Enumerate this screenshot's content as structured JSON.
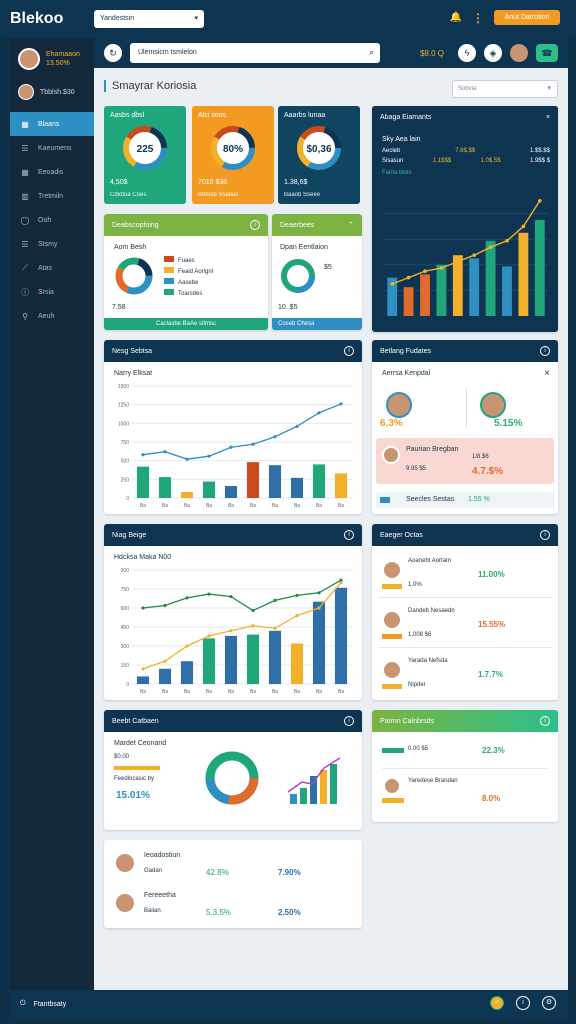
{
  "app": {
    "logo": "Blekoo",
    "workspace_select": "Yandestsin",
    "top_button": "Anut Datrotion"
  },
  "sidebar": {
    "user_name": "Ehamaaon",
    "user_sub": "13.50%",
    "workspace": "Tbblsh.$30",
    "items": [
      {
        "label": "Blaans",
        "icon": "table-icon"
      },
      {
        "label": "Kaeumens",
        "icon": "list-icon"
      },
      {
        "label": "Eeoadis",
        "icon": "table-icon"
      },
      {
        "label": "Tretmiln",
        "icon": "grid-icon"
      },
      {
        "label": "Ooh",
        "icon": "circle-icon"
      },
      {
        "label": "Stsmy",
        "icon": "list-icon"
      },
      {
        "label": "Atas",
        "icon": "chart-icon"
      },
      {
        "label": "Srsia",
        "icon": "info-icon"
      },
      {
        "label": "Aeuh",
        "icon": "pin-icon"
      }
    ]
  },
  "search": {
    "placeholder": "Ulemsicm tsmlelon",
    "status": "$8.0 Q"
  },
  "page": {
    "title": "Smayrar Koriosia",
    "filter": "Sobvia"
  },
  "kpis": [
    {
      "title": "Aasbs dbsl",
      "center": "225",
      "value": "4,50$",
      "sub": "Cdiotoa Coes",
      "color": "#1fa67a"
    },
    {
      "title": "Alci soos",
      "center": "80%",
      "value": "7010 $38",
      "sub": "Bdmsb Ssabus",
      "color": "#f39a22"
    },
    {
      "title": "Aaarbs lunaa",
      "center": "$0,36",
      "value": "1.38,6$",
      "sub": "Baaob Sseee",
      "color": "#0f4561"
    }
  ],
  "breakdown": {
    "title": "Deabscopfoing",
    "heading": "Aom Besh",
    "legend": [
      "Fuaes",
      "Feaid Aorlgnl",
      "Aasebe",
      "Toarsdes"
    ],
    "total": "7.58",
    "footer": "Caclasbe BaAe stimsc"
  },
  "dist": {
    "title": "Deaerbees",
    "heading": "Dpan Eentlaion",
    "value": "$5",
    "total": "10. $5",
    "footer": "Coseb Chesa"
  },
  "big": {
    "title": "Abaga Eiamants",
    "heading": "Sky Aea lain",
    "r1": [
      "Aecleb",
      "7.6$.$$",
      "1.$$.$$"
    ],
    "r2": [
      "Sisasun",
      "1.1$$$",
      "1.0$.5$",
      "1.9$$ $"
    ],
    "link": "Fanta blots"
  },
  "bar_card": {
    "title": "Nesg Sebtsa",
    "heading": "Narry Elksat"
  },
  "profiles": {
    "title": "Betlang Fudates",
    "heading": "Aerrsa Kenpdal",
    "p1": "6.3%",
    "p2": "5.15%",
    "hl_name": "Paurian Bregban",
    "hl_sub": "9.95 $5",
    "hl_v1": "1/8.$6",
    "hl_v2": "4.7.$%",
    "sub_lbl": "Seecles Sestas",
    "sub_pct": "1.55 %"
  },
  "line_card": {
    "title": "Niag Beige",
    "heading": "Hdcksa Maka N00"
  },
  "people": {
    "title": "Eaeger Octas",
    "rows": [
      {
        "name": "Aoanebt Aortam",
        "v": "1.0%",
        "pct": "11.00%",
        "cls": "pos"
      },
      {
        "name": "Dandeb Nesaedn",
        "v": "1,008 $6",
        "pct": "15.55%",
        "cls": "neg"
      },
      {
        "name": "Yarada Nefsda",
        "v": "Nipder",
        "pct": "1.7.7%",
        "cls": "pos"
      }
    ]
  },
  "small_card": {
    "title": "Beebt Catbaen",
    "heading": "Mardet Ceonand",
    "val": "$0.00",
    "sub": "Feedlocasic by",
    "pct": "15.01%"
  },
  "side_card": {
    "title": "Parmn Calnbrsds",
    "r1": {
      "v": "0.00 $5",
      "pct": "22.3%"
    },
    "r2": {
      "name": "Yaredese Brandan",
      "pct": "8.0%"
    }
  },
  "bottom": {
    "rows": [
      {
        "name": "Ieoadostiun",
        "sub": "Gadan",
        "v1": "42.8%",
        "v2": "7.90%"
      },
      {
        "name": "Fereeetha",
        "sub": "Baiian",
        "v1": "5.3.5%",
        "v2": "2.50%"
      }
    ]
  },
  "footer": {
    "label": "Ftantbsaty"
  },
  "chart_data": [
    {
      "type": "bar",
      "title": "Narry Elksat",
      "categories": [
        "Ba",
        "Ba",
        "Ba",
        "Ba",
        "Ba",
        "Ba",
        "Ba",
        "Ba",
        "Ba",
        "Ba"
      ],
      "values": [
        420,
        280,
        80,
        220,
        160,
        480,
        440,
        270,
        450,
        330
      ],
      "ylim": [
        0,
        1500
      ],
      "yticks": [
        0,
        250,
        500,
        750,
        1000,
        1250,
        1500
      ],
      "colors": [
        "#1fa67a",
        "#1fa67a",
        "#f3b02a",
        "#1fa67a",
        "#2e6fa8",
        "#c94a1c",
        "#2e6fa8",
        "#2e6fa8",
        "#1fa67a",
        "#f3b02a"
      ],
      "line": [
        580,
        620,
        520,
        560,
        680,
        720,
        820,
        960,
        1140,
        1260
      ]
    },
    {
      "type": "bar",
      "title": "Hdcksa Maka N00",
      "categories": [
        "Ba",
        "Ba",
        "Ba",
        "Ba",
        "Ba",
        "Ba",
        "Ba",
        "Ba",
        "Ba",
        "Ba"
      ],
      "values": [
        60,
        120,
        180,
        360,
        380,
        390,
        420,
        320,
        650,
        760
      ],
      "ylim": [
        0,
        900
      ],
      "yticks": [
        0,
        150,
        300,
        450,
        600,
        750,
        900
      ],
      "line_a": [
        600,
        620,
        680,
        710,
        690,
        580,
        660,
        700,
        720,
        820
      ],
      "line_b": [
        120,
        180,
        300,
        380,
        420,
        460,
        440,
        540,
        600,
        800
      ]
    },
    {
      "type": "bar",
      "title": "Sky Aea lain",
      "values": [
        240,
        180,
        260,
        320,
        380,
        360,
        470,
        310,
        520,
        600
      ],
      "colors": [
        "#2e8fc2",
        "#e06c2c",
        "#e06c2c",
        "#1fa67a",
        "#f3b02a",
        "#2e8fc2",
        "#1fa67a",
        "#2e8fc2",
        "#f3b02a",
        "#1fa67a"
      ],
      "line": [
        200,
        240,
        280,
        300,
        340,
        380,
        430,
        470,
        560,
        720
      ],
      "ylim": [
        0,
        800
      ]
    }
  ]
}
